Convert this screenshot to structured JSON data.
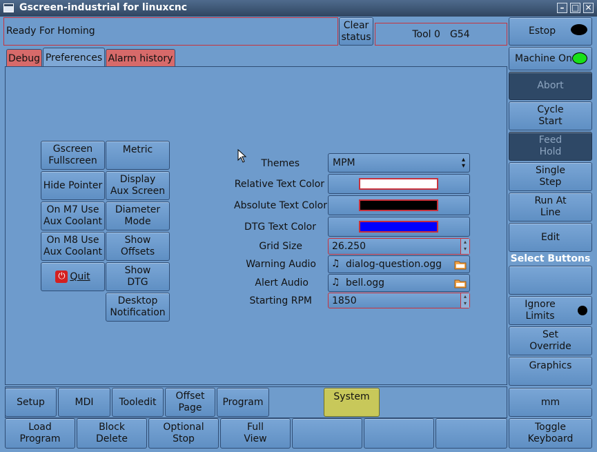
{
  "window": {
    "title": "Gscreen-industrial for linuxcnc"
  },
  "status": {
    "message": "Ready For Homing",
    "clear_label": "Clear\nstatus",
    "tool": "Tool 0",
    "coord": "G54"
  },
  "tabs": [
    {
      "label": "Debug"
    },
    {
      "label": "Preferences"
    },
    {
      "label": "Alarm history"
    }
  ],
  "prefs": {
    "fullscreen": "Gscreen\nFullscreen",
    "metric": "Metric",
    "hide_pointer": "Hide Pointer",
    "display_aux": "Display\nAux Screen",
    "m7": "On M7 Use\nAux Coolant",
    "diameter": "Diameter\nMode",
    "m8": "On M8 Use\nAux Coolant",
    "show_offsets": "Show\nOffsets",
    "quit": "Quit",
    "show_dtg": "Show\nDTG",
    "desktop_notify": "Desktop\nNotification"
  },
  "settings": {
    "themes_label": "Themes",
    "themes_value": "MPM",
    "rel_label": "Relative Text Color",
    "rel_color": "#ffffff",
    "abs_label": "Absolute Text Color",
    "abs_color": "#000000",
    "dtg_label": "DTG Text Color",
    "dtg_color": "#0000ff",
    "grid_label": "Grid Size",
    "grid_value": "26.250",
    "warn_label": "Warning Audio",
    "warn_value": "dialog-question.ogg",
    "alert_label": "Alert Audio",
    "alert_value": "bell.ogg",
    "rpm_label": "Starting RPM",
    "rpm_value": "1850"
  },
  "right": {
    "estop": "Estop",
    "machine_on": "Machine On",
    "abort": "Abort",
    "cycle_start": "Cycle\nStart",
    "feed_hold": "Feed\nHold",
    "single_step": "Single\nStep",
    "run_at_line": "Run At\nLine",
    "edit": "Edit",
    "select_header": "Select Buttons",
    "ignore_limits": "Ignore\nLimits",
    "set_override": "Set\nOverride",
    "graphics": "Graphics",
    "units": "mm",
    "toggle_keyboard": "Toggle\nKeyboard"
  },
  "modes": [
    {
      "label": "Setup"
    },
    {
      "label": "MDI"
    },
    {
      "label": "Tooledit"
    },
    {
      "label": "Offset\nPage"
    },
    {
      "label": "Program"
    },
    {
      "label": "System"
    }
  ],
  "bottom": [
    {
      "label": "Load\nProgram"
    },
    {
      "label": "Block\nDelete"
    },
    {
      "label": "Optional\nStop"
    },
    {
      "label": "Full\nView"
    },
    {
      "label": ""
    },
    {
      "label": ""
    },
    {
      "label": ""
    }
  ]
}
